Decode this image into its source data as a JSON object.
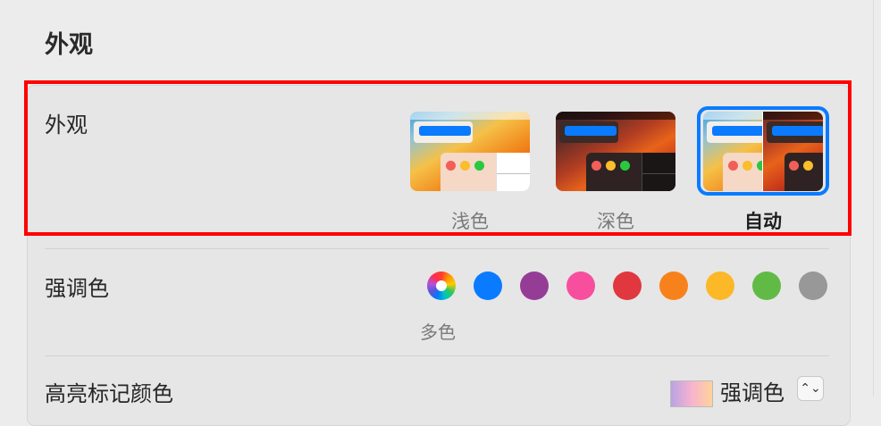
{
  "section_title": "外观",
  "appearance": {
    "label": "外观",
    "options": [
      {
        "id": "light",
        "caption": "浅色",
        "selected": false
      },
      {
        "id": "dark",
        "caption": "深色",
        "selected": false
      },
      {
        "id": "auto",
        "caption": "自动",
        "selected": true
      }
    ]
  },
  "accent": {
    "label": "强调色",
    "selected_caption": "多色",
    "colors": [
      {
        "name": "multicolor",
        "hex": "multi"
      },
      {
        "name": "blue",
        "hex": "#0a7bff"
      },
      {
        "name": "purple",
        "hex": "#953d96"
      },
      {
        "name": "pink",
        "hex": "#f74f9e"
      },
      {
        "name": "red",
        "hex": "#e0383e"
      },
      {
        "name": "orange",
        "hex": "#f7821b"
      },
      {
        "name": "yellow",
        "hex": "#fcb827"
      },
      {
        "name": "green",
        "hex": "#62ba46"
      },
      {
        "name": "graphite",
        "hex": "#989898"
      }
    ]
  },
  "highlight": {
    "label": "高亮标记颜色",
    "value": "强调色",
    "stepper_icon": "⌃⌄"
  },
  "icons": {
    "apple": ""
  }
}
